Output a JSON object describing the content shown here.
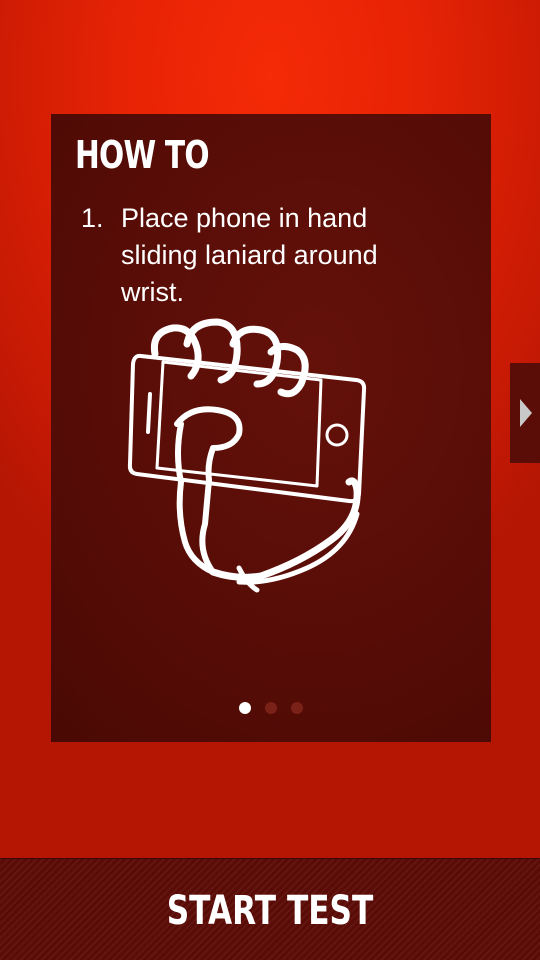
{
  "card": {
    "title": "HOW TO",
    "step": {
      "number": "1.",
      "text": "Place phone in hand sliding laniard around wrist."
    },
    "illustration_icon": "hand-holding-phone-icon"
  },
  "pager": {
    "total": 3,
    "active": 1
  },
  "navigation": {
    "next_icon": "chevron-right-icon"
  },
  "action": {
    "start_label": "START TEST"
  },
  "colors": {
    "background": "#e62305",
    "card": "#560c06",
    "bar": "#5a0b06",
    "text": "#ffffff"
  }
}
